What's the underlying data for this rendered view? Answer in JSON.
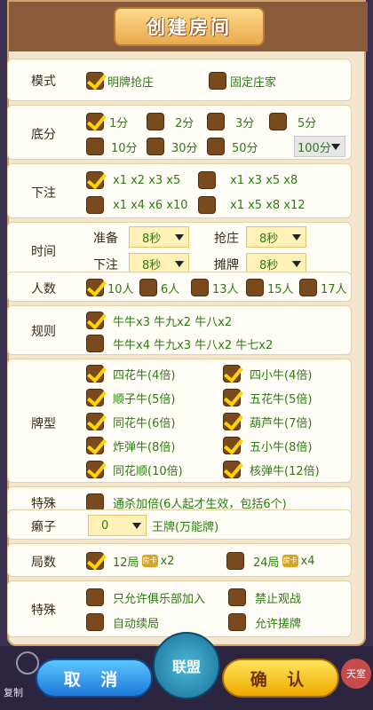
{
  "title": "创建房间",
  "mode": {
    "label": "模式",
    "options": [
      {
        "text": "明牌抢庄",
        "checked": true
      },
      {
        "text": "固定庄家",
        "checked": false
      }
    ]
  },
  "base": {
    "label": "底分",
    "options": [
      {
        "text": "1分",
        "checked": true
      },
      {
        "text": "2分",
        "checked": false
      },
      {
        "text": "3分",
        "checked": false
      },
      {
        "text": "5分",
        "checked": false
      },
      {
        "text": "10分",
        "checked": false
      },
      {
        "text": "30分",
        "checked": false
      },
      {
        "text": "50分",
        "checked": false
      }
    ],
    "select": "100分"
  },
  "bet": {
    "label": "下注",
    "options": [
      {
        "text": "x1 x2 x3 x5",
        "checked": true
      },
      {
        "text": "x1 x3 x5 x8",
        "checked": false
      },
      {
        "text": "x1 x4 x6 x10",
        "checked": false
      },
      {
        "text": "x1 x5 x8 x12",
        "checked": false
      }
    ]
  },
  "time": {
    "label": "时间",
    "prepare": {
      "label": "准备",
      "value": "8秒"
    },
    "grab": {
      "label": "抢庄",
      "value": "8秒"
    },
    "bet": {
      "label": "下注",
      "value": "8秒"
    },
    "show": {
      "label": "摊牌",
      "value": "8秒"
    }
  },
  "players": {
    "label": "人数",
    "options": [
      {
        "text": "10人",
        "checked": true
      },
      {
        "text": "6人",
        "checked": false
      },
      {
        "text": "13人",
        "checked": false
      },
      {
        "text": "15人",
        "checked": false
      },
      {
        "text": "17人",
        "checked": false
      }
    ]
  },
  "rules": {
    "label": "规则",
    "options": [
      {
        "text": "牛牛x3 牛九x2 牛八x2",
        "checked": true
      },
      {
        "text": "牛牛x4 牛九x3 牛八x2 牛七x2",
        "checked": false
      }
    ]
  },
  "cards": {
    "label": "牌型",
    "options": [
      {
        "text": "四花牛(4倍)",
        "checked": true
      },
      {
        "text": "四小牛(4倍)",
        "checked": true
      },
      {
        "text": "顺子牛(5倍)",
        "checked": true
      },
      {
        "text": "五花牛(5倍)",
        "checked": true
      },
      {
        "text": "同花牛(6倍)",
        "checked": true
      },
      {
        "text": "葫芦牛(7倍)",
        "checked": true
      },
      {
        "text": "炸弹牛(8倍)",
        "checked": true
      },
      {
        "text": "五小牛(8倍)",
        "checked": true
      },
      {
        "text": "同花顺(10倍)",
        "checked": true
      },
      {
        "text": "核弹牛(12倍)",
        "checked": true
      }
    ]
  },
  "special1": {
    "label": "特殊",
    "options": [
      {
        "text": "通杀加倍(6人起才生效，包括6个)",
        "checked": false
      }
    ]
  },
  "wild": {
    "label": "癞子",
    "select": "0",
    "note": "王牌(万能牌)"
  },
  "rounds": {
    "label": "局数",
    "options": [
      {
        "text": "12局",
        "suffix": "x2",
        "checked": true
      },
      {
        "text": "24局",
        "suffix": "x4",
        "checked": false
      }
    ],
    "badge": "房卡"
  },
  "special2": {
    "label": "特殊",
    "options": [
      {
        "text": "只允许俱乐部加入",
        "checked": false
      },
      {
        "text": "禁止观战",
        "checked": false
      },
      {
        "text": "自动续局",
        "checked": false
      },
      {
        "text": "允许搓牌",
        "checked": false
      }
    ]
  },
  "buttons": {
    "cancel": "取 消",
    "ok": "确 认",
    "union": "联盟",
    "copy": "复制",
    "tianxia": "天室"
  }
}
